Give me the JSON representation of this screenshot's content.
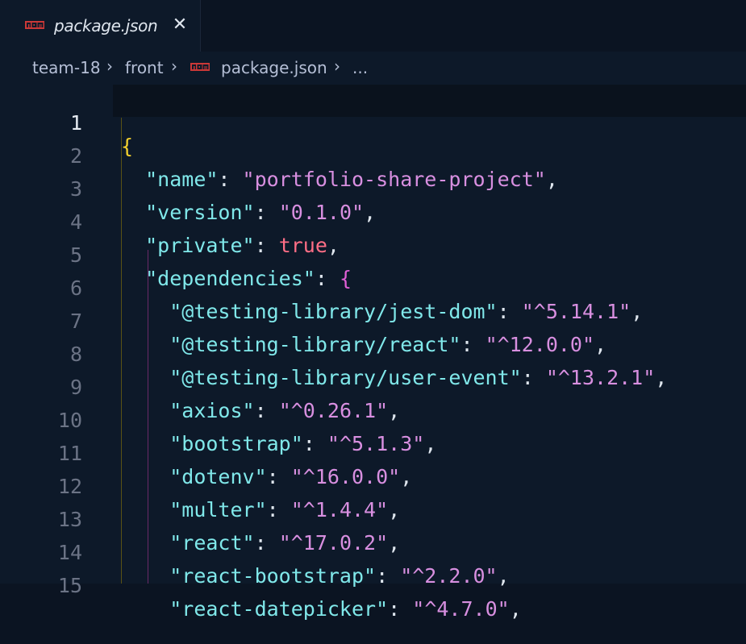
{
  "tab": {
    "icon": "npm-icon",
    "label": "package.json",
    "close_glyph": "✕"
  },
  "breadcrumb": {
    "items": [
      "team-18",
      "front",
      "package.json",
      "..."
    ],
    "separator": "›",
    "file_icon": "npm-icon"
  },
  "editor": {
    "active_line": 1,
    "lines": [
      {
        "n": "1"
      },
      {
        "n": "2"
      },
      {
        "n": "3"
      },
      {
        "n": "4"
      },
      {
        "n": "5"
      },
      {
        "n": "6"
      },
      {
        "n": "7"
      },
      {
        "n": "8"
      },
      {
        "n": "9"
      },
      {
        "n": "10"
      },
      {
        "n": "11"
      },
      {
        "n": "12"
      },
      {
        "n": "13"
      },
      {
        "n": "14"
      },
      {
        "n": "15"
      }
    ],
    "code": {
      "l1": "{",
      "name_key": "\"name\"",
      "name_val": "\"portfolio-share-project\"",
      "version_key": "\"version\"",
      "version_val": "\"0.1.0\"",
      "private_key": "\"private\"",
      "private_val": "true",
      "deps_key": "\"dependencies\"",
      "deps_open": "{",
      "deps": [
        {
          "key": "\"@testing-library/jest-dom\"",
          "val": "\"^5.14.1\""
        },
        {
          "key": "\"@testing-library/react\"",
          "val": "\"^12.0.0\""
        },
        {
          "key": "\"@testing-library/user-event\"",
          "val": "\"^13.2.1\""
        },
        {
          "key": "\"axios\"",
          "val": "\"^0.26.1\""
        },
        {
          "key": "\"bootstrap\"",
          "val": "\"^5.1.3\""
        },
        {
          "key": "\"dotenv\"",
          "val": "\"^16.0.0\""
        },
        {
          "key": "\"multer\"",
          "val": "\"^1.4.4\""
        },
        {
          "key": "\"react\"",
          "val": "\"^17.0.2\""
        },
        {
          "key": "\"react-bootstrap\"",
          "val": "\"^2.2.0\""
        },
        {
          "key": "\"react-datepicker\"",
          "val": "\"^4.7.0\""
        }
      ]
    }
  },
  "colors": {
    "background": "#0d1929",
    "key": "#80e8ea",
    "string": "#d88fe0",
    "boolean": "#ff6e86",
    "brace_outer": "#f5d22e",
    "brace_inner": "#e05fd6"
  }
}
